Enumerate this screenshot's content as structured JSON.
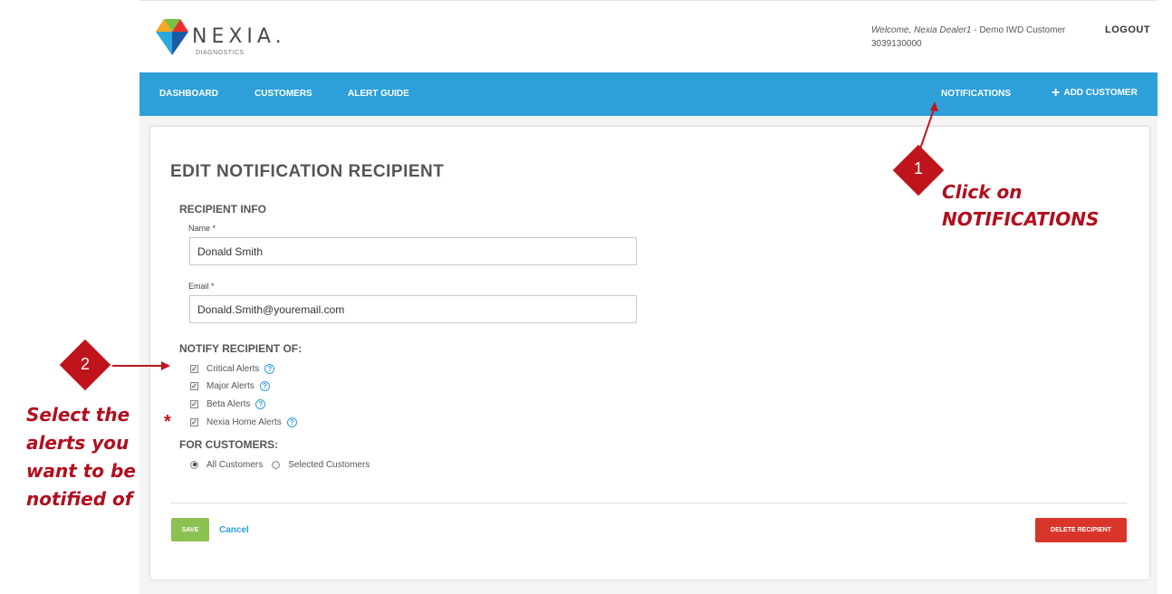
{
  "header": {
    "logo_word": "NEXIA.",
    "logo_sub": "DIAGNOSTICS",
    "welcome_prefix": "Welcome,",
    "welcome_name": "Nexia Dealer1",
    "welcome_suffix": " - Demo IWD Customer",
    "phone": "3039130000",
    "logout": "LOGOUT"
  },
  "nav": {
    "dashboard": "DASHBOARD",
    "customers": "CUSTOMERS",
    "alert_guide": "ALERT GUIDE",
    "notifications": "NOTIFICATIONS",
    "add_customer": "ADD CUSTOMER"
  },
  "form": {
    "title": "EDIT NOTIFICATION RECIPIENT",
    "recipient_info": "RECIPIENT INFO",
    "name_label": "Name *",
    "name_value": "Donald Smith",
    "email_label": "Email *",
    "email_value": "Donald.Smith@youremail.com",
    "notify_title": "NOTIFY RECIPIENT OF:",
    "alerts": [
      {
        "label": "Critical Alerts",
        "checked": true
      },
      {
        "label": "Major Alerts",
        "checked": true
      },
      {
        "label": "Beta Alerts",
        "checked": true
      },
      {
        "label": "Nexia Home Alerts",
        "checked": true
      }
    ],
    "customers_title": "FOR CUSTOMERS:",
    "customer_options": [
      {
        "label": "All Customers",
        "selected": true
      },
      {
        "label": "Selected Customers",
        "selected": false
      }
    ],
    "save": "SAVE",
    "cancel": "Cancel",
    "delete": "DELETE RECIPIENT"
  },
  "annotations": {
    "step1_number": "1",
    "step1_line1": "Click on",
    "step1_line2": "NOTIFICATIONS",
    "step2_number": "2",
    "step2_line1": "Select the",
    "step2_line2": "alerts you",
    "step2_line3": "want to be",
    "step2_line4": "notified of",
    "asterisk": "*"
  },
  "colors": {
    "nav_blue": "#2d9fd9",
    "save_green": "#8cc152",
    "delete_red": "#d9362b",
    "annotation_red": "#b10e1e"
  },
  "icons": [
    "nexia-logo-icon",
    "plus-icon",
    "help-icon",
    "checkbox-icon",
    "radio-icon",
    "arrow-icon"
  ]
}
